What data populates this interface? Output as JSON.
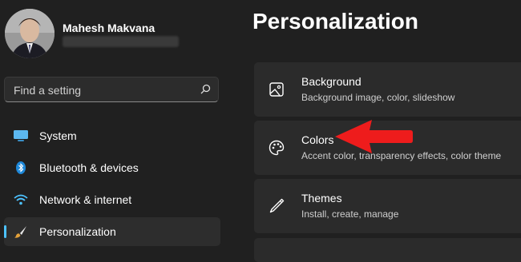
{
  "user": {
    "name": "Mahesh Makvana"
  },
  "search": {
    "placeholder": "Find a setting"
  },
  "sidebar": {
    "items": [
      {
        "label": "System",
        "icon": "monitor-icon"
      },
      {
        "label": "Bluetooth & devices",
        "icon": "bluetooth-icon"
      },
      {
        "label": "Network & internet",
        "icon": "wifi-icon"
      },
      {
        "label": "Personalization",
        "icon": "brush-icon",
        "active": true
      }
    ]
  },
  "main": {
    "title": "Personalization",
    "cards": [
      {
        "title": "Background",
        "subtitle": "Background image, color, slideshow",
        "icon": "image-icon"
      },
      {
        "title": "Colors",
        "subtitle": "Accent color, transparency effects, color theme",
        "icon": "palette-icon"
      },
      {
        "title": "Themes",
        "subtitle": "Install, create, manage",
        "icon": "pen-icon"
      }
    ]
  },
  "colors": {
    "accent": "#4cc2ff",
    "annotation_arrow": "#ee1c1c",
    "background": "#202020",
    "card": "#2b2b2b"
  }
}
